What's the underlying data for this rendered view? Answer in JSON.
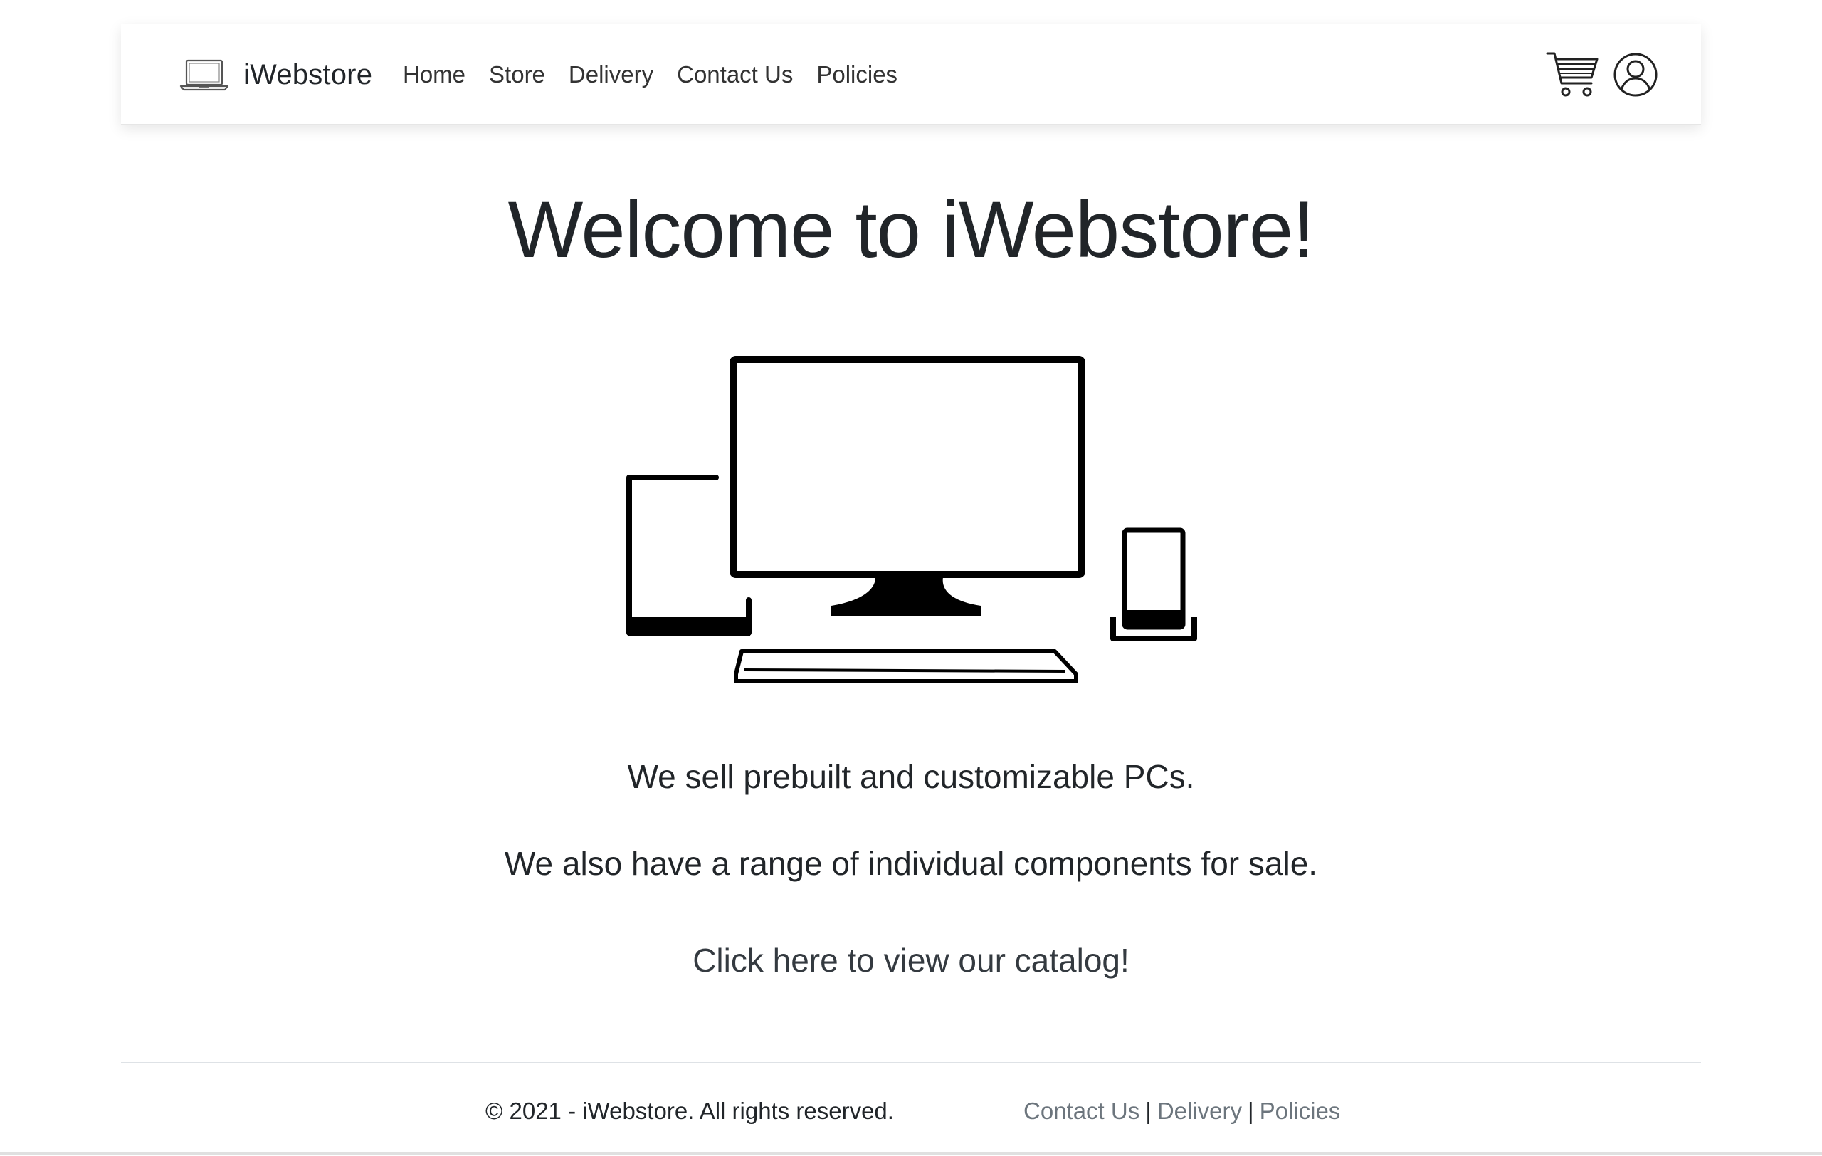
{
  "navbar": {
    "brand_icon": "laptop-icon",
    "brand_name": "iWebstore",
    "links": [
      {
        "label": "Home"
      },
      {
        "label": "Store"
      },
      {
        "label": "Delivery"
      },
      {
        "label": "Contact Us"
      },
      {
        "label": "Policies"
      }
    ],
    "actions": {
      "cart_icon": "shopping-cart-icon",
      "account_icon": "user-circle-icon"
    }
  },
  "main": {
    "title": "Welcome to iWebstore!",
    "illustration_icon": "devices-icon",
    "tagline_1": "We sell prebuilt and customizable PCs.",
    "tagline_2": "We also have a range of individual components for sale.",
    "catalog_link": "Click here to view our catalog!"
  },
  "footer": {
    "copyright": "© 2021 - iWebstore. All rights reserved.",
    "links": [
      {
        "label": "Contact Us"
      },
      {
        "label": "Delivery"
      },
      {
        "label": "Policies"
      }
    ],
    "separator": "|"
  },
  "colors": {
    "text": "#212529",
    "muted_link": "#6c757d",
    "divider": "#dee2e6",
    "background": "#ffffff"
  }
}
